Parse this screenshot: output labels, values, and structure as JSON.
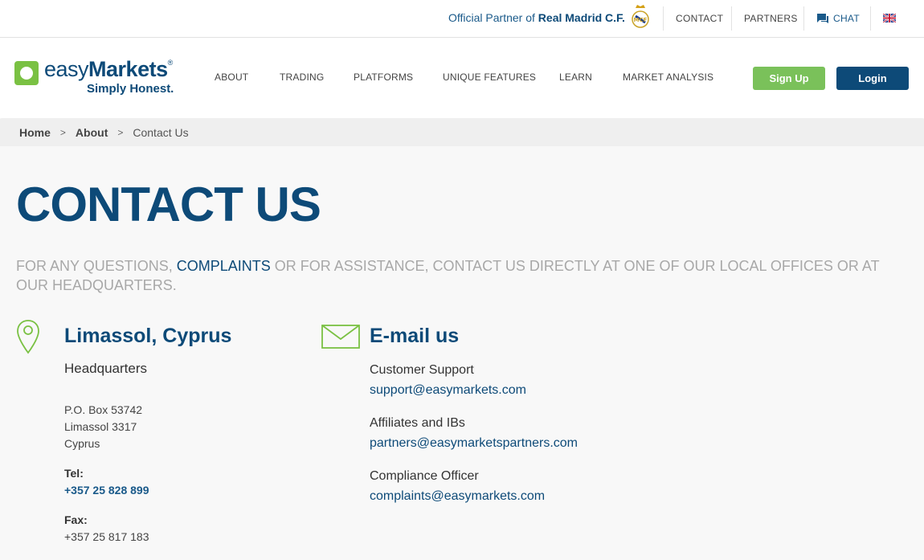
{
  "topbar": {
    "partner_prefix": "Official Partner of",
    "partner_name": "Real Madrid C.F.",
    "contact": "CONTACT",
    "partners": "PARTNERS",
    "chat": "CHAT"
  },
  "header": {
    "logo_easy": "easy",
    "logo_markets": "Markets",
    "logo_reg": "®",
    "tagline": "Simply Honest.",
    "nav": [
      "ABOUT",
      "TRADING",
      "PLATFORMS",
      "UNIQUE FEATURES",
      "LEARN",
      "MARKET ANALYSIS"
    ],
    "signup": "Sign Up",
    "login": "Login"
  },
  "breadcrumb": {
    "home": "Home",
    "sep": ">",
    "about": "About",
    "current": "Contact Us"
  },
  "main": {
    "title": "CONTACT US",
    "intro_prefix": "FOR ANY QUESTIONS,",
    "intro_link": "COMPLAINTS",
    "intro_suffix": "OR FOR ASSISTANCE, CONTACT US DIRECTLY AT ONE OF OUR LOCAL OFFICES OR AT OUR HEADQUARTERS.",
    "office": {
      "title": "Limassol, Cyprus",
      "subtitle": "Headquarters",
      "address": [
        "P.O. Box 53742",
        "Limassol 3317",
        "Cyprus"
      ],
      "tel_label": "Tel:",
      "tel": "+357 25 828 899",
      "fax_label": "Fax:",
      "fax": "+357 25 817 183"
    },
    "email": {
      "title": "E-mail us",
      "entries": [
        {
          "label": "Customer Support",
          "address": "support@easymarkets.com"
        },
        {
          "label": "Affiliates and IBs",
          "address": "partners@easymarketspartners.com"
        },
        {
          "label": "Compliance Officer",
          "address": "complaints@easymarkets.com"
        }
      ]
    }
  },
  "colors": {
    "brand_blue": "#0d4a78",
    "brand_green": "#7ac143",
    "signup_green": "#7ac15a"
  },
  "icons": [
    "real-madrid-crest-icon",
    "chat-icon",
    "uk-flag-icon",
    "location-pin-icon",
    "envelope-icon"
  ]
}
